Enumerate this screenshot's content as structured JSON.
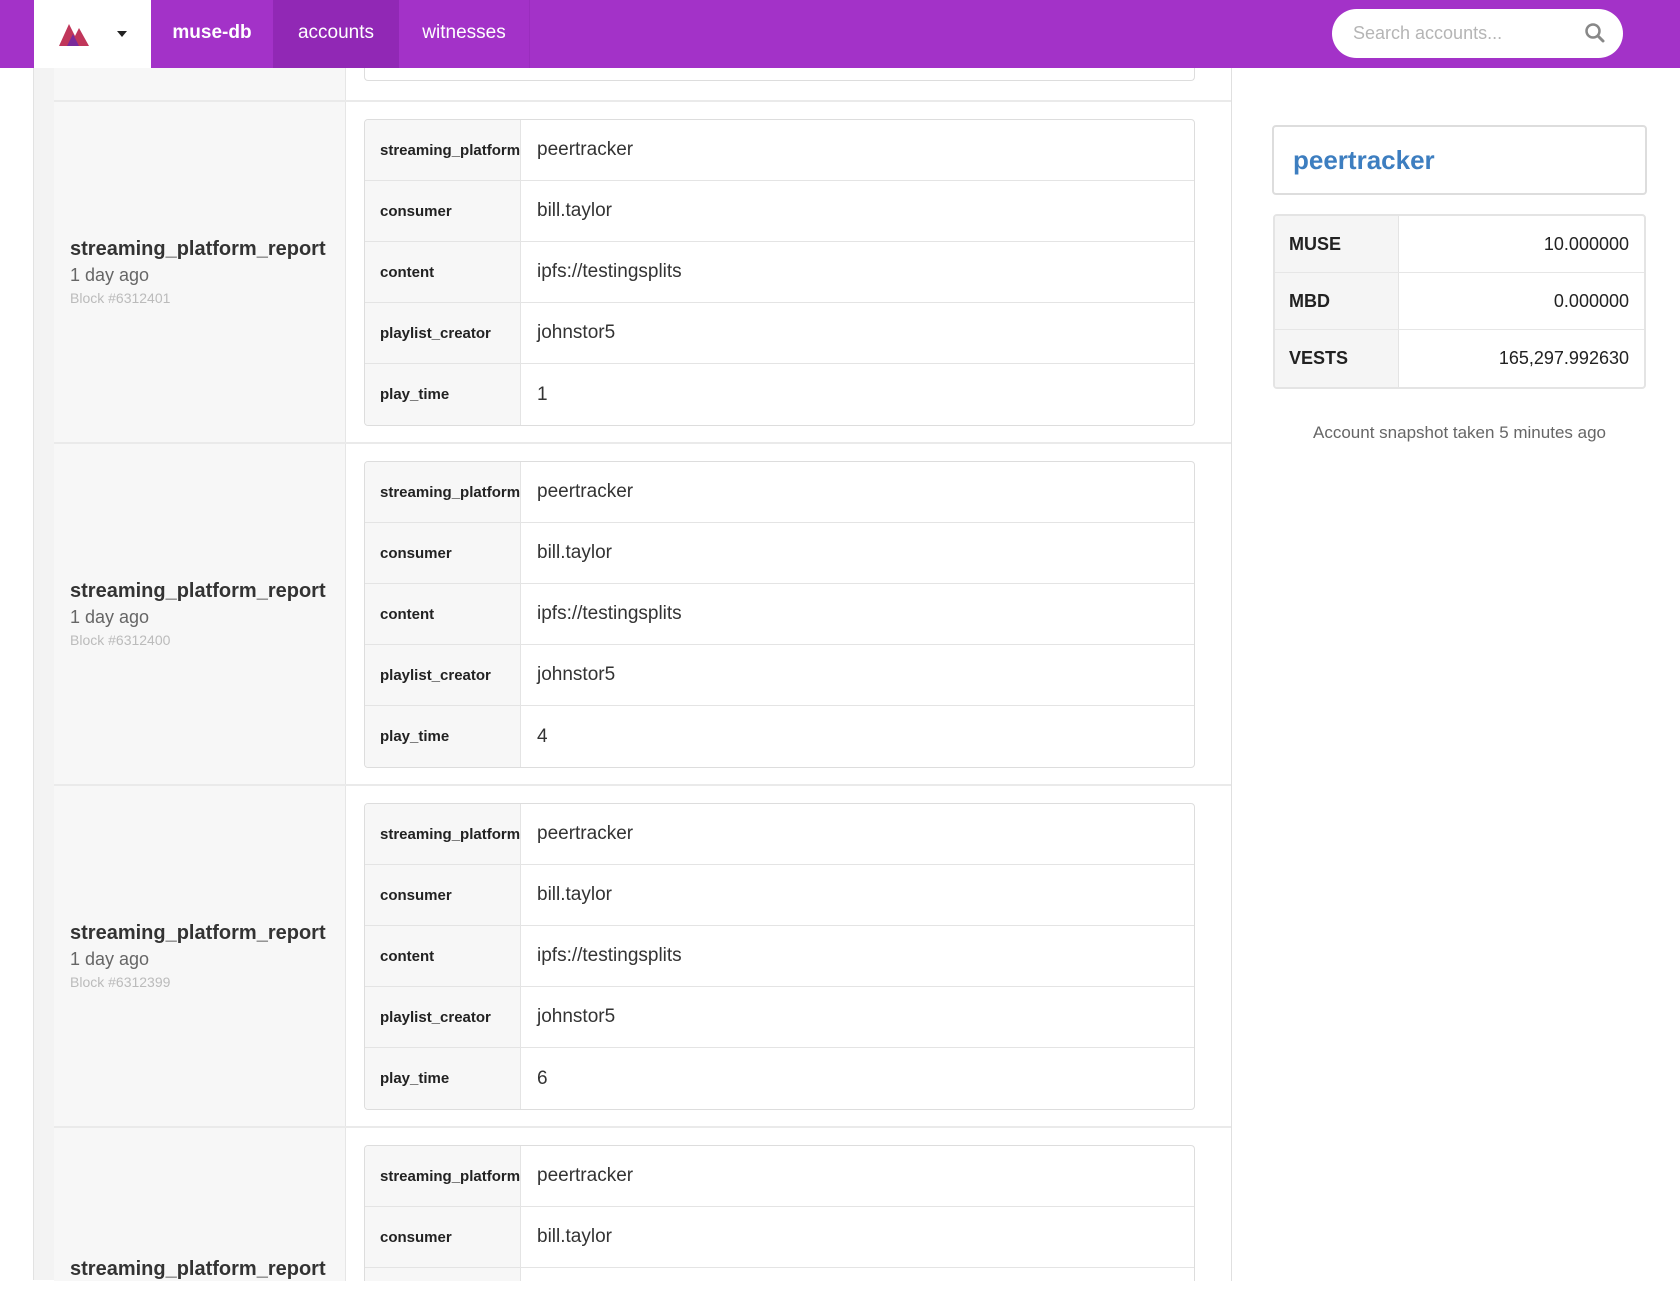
{
  "nav": {
    "brand": "muse-db",
    "links": [
      "accounts",
      "witnesses"
    ],
    "search_placeholder": "Search accounts...",
    "accent": "#a332c8"
  },
  "operations": [
    {
      "title": "streaming_platform_report",
      "ago": "1 day ago",
      "block": "Block #6312401",
      "fields": [
        [
          "streaming_platform",
          "peertracker"
        ],
        [
          "consumer",
          "bill.taylor"
        ],
        [
          "content",
          "ipfs://testingsplits"
        ],
        [
          "playlist_creator",
          "johnstor5"
        ],
        [
          "play_time",
          "1"
        ]
      ]
    },
    {
      "title": "streaming_platform_report",
      "ago": "1 day ago",
      "block": "Block #6312400",
      "fields": [
        [
          "streaming_platform",
          "peertracker"
        ],
        [
          "consumer",
          "bill.taylor"
        ],
        [
          "content",
          "ipfs://testingsplits"
        ],
        [
          "playlist_creator",
          "johnstor5"
        ],
        [
          "play_time",
          "4"
        ]
      ]
    },
    {
      "title": "streaming_platform_report",
      "ago": "1 day ago",
      "block": "Block #6312399",
      "fields": [
        [
          "streaming_platform",
          "peertracker"
        ],
        [
          "consumer",
          "bill.taylor"
        ],
        [
          "content",
          "ipfs://testingsplits"
        ],
        [
          "playlist_creator",
          "johnstor5"
        ],
        [
          "play_time",
          "6"
        ]
      ]
    },
    {
      "title": "streaming_platform_report",
      "fields": [
        [
          "streaming_platform",
          "peertracker"
        ],
        [
          "consumer",
          "bill.taylor"
        ],
        [
          "",
          ""
        ]
      ]
    }
  ],
  "account": {
    "name": "peertracker",
    "balances": [
      [
        "MUSE",
        "10.000000"
      ],
      [
        "MBD",
        "0.000000"
      ],
      [
        "VESTS",
        "165,297.992630"
      ]
    ],
    "snapshot": "Account snapshot taken 5 minutes ago"
  }
}
